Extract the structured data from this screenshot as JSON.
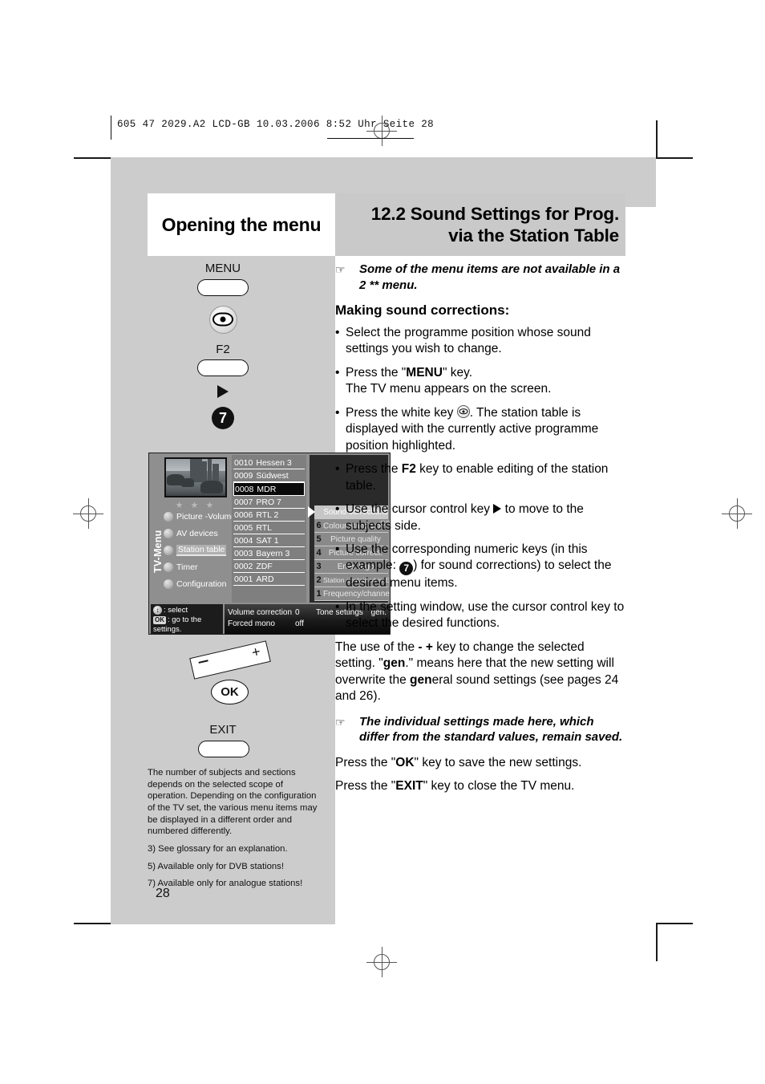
{
  "slug": "605 47 2029.A2 LCD-GB  10.03.2006  8:52 Uhr  Seite 28",
  "titles": {
    "left": "Opening the menu",
    "right_line1": "12.2 Sound Settings for Prog.",
    "right_line2": "via the Station Table"
  },
  "keys": {
    "menu_label": "MENU",
    "f2_label": "F2",
    "number_key": "7",
    "ok_label": "OK",
    "exit_label": "EXIT",
    "minus": "–",
    "plus": "+"
  },
  "tv": {
    "vertical_label": "TV-Menu",
    "stars": "★ ★ ★",
    "menu_items": [
      {
        "label": "Picture -Volume",
        "selected": false
      },
      {
        "label": "AV devices",
        "selected": false
      },
      {
        "label": "Station table",
        "selected": true
      },
      {
        "label": "Timer",
        "selected": false
      },
      {
        "label": "Configuration",
        "selected": false
      }
    ],
    "stations": [
      {
        "no": "0010",
        "name": "Hessen 3",
        "active": false
      },
      {
        "no": "0009",
        "name": "Südwest",
        "active": false
      },
      {
        "no": "0008",
        "name": "MDR",
        "active": true
      },
      {
        "no": "0007",
        "name": "PRO 7",
        "active": false
      },
      {
        "no": "0006",
        "name": "RTL 2",
        "active": false
      },
      {
        "no": "0005",
        "name": "RTL",
        "active": false
      },
      {
        "no": "0004",
        "name": "SAT 1",
        "active": false
      },
      {
        "no": "0003",
        "name": "Bayern 3",
        "active": false
      },
      {
        "no": "0002",
        "name": "ZDF",
        "active": false
      },
      {
        "no": "0001",
        "name": "ARD",
        "active": false
      }
    ],
    "subjects": [
      {
        "key": "",
        "label": "Sound corrections",
        "sup": "",
        "selected": true
      },
      {
        "key": "6",
        "label": "Colour standard",
        "sup": "3)7)",
        "selected": false
      },
      {
        "key": "5",
        "label": "Picture quality",
        "sup": "",
        "selected": false
      },
      {
        "key": "4",
        "label": "Picture correct.",
        "sup": "",
        "selected": false
      },
      {
        "key": "3",
        "label": "Enter logo",
        "sup": "",
        "selected": false
      },
      {
        "key": "2",
        "label": "Station contained in EPG",
        "sup": "",
        "selected": false
      },
      {
        "key": "1",
        "label": "Frequency/channel",
        "sup": "",
        "selected": false
      }
    ],
    "hint": {
      "line1": ": select",
      "line2": ": go to the",
      "line3": "settings.",
      "ok_badge": "OK"
    },
    "status": {
      "label1": "Volume correction",
      "value1": "0",
      "label2": "Tone settings",
      "value2": "gen.",
      "label3": "Forced mono",
      "value3": "off"
    }
  },
  "right": {
    "note1": "Some of the menu items are not available in a 2 ** menu.",
    "subhead": "Making sound corrections:",
    "b1": "Select the programme position whose sound settings you wish to change.",
    "b2_a": "Press the \"",
    "b2_b": "MENU",
    "b2_c": "\" key.",
    "b2_d": "The TV menu appears on the screen.",
    "b3_a": "Press the white key ",
    "b3_b": ". The station table is displayed with the currently active programme position highlighted.",
    "b4_a": "Press the ",
    "b4_b": "F2",
    "b4_c": " key to enable editing of the station table.",
    "b5_a": "Use the cursor control key ",
    "b5_b": " to move to the subjects side.",
    "b6_a": "Use the corresponding numeric keys (in this example: ",
    "b6_b": "7",
    "b6_c": ") for sound corrections) to select the desired menu items.",
    "b7": "In the setting window, use the cursor control key to select the desired functions.",
    "p1_a": "The use of the ",
    "p1_minus": "-",
    "p1_plus": "+",
    "p1_b": " key to change the selected setting. \"",
    "p1_gen": "gen",
    "p1_c": ".\" means here that the new setting will overwrite the ",
    "p1_gen2": "gen",
    "p1_d": "eral sound settings (see pages 24 and 26).",
    "note2": "The individual settings made here, which differ from the standard values, remain saved.",
    "p2_a": "Press the \"",
    "p2_ok": "OK",
    "p2_b": "\" key to save the new settings.",
    "p3_a": "Press the \"",
    "p3_exit": "EXIT",
    "p3_b": "\" key to close the TV menu."
  },
  "footnotes": {
    "main": "The number of subjects and sections depends on the selected scope of operation. Depending on the configuration of the TV set, the various menu items may be displayed in a different order and numbered differently.",
    "f3": "3) See glossary for an explanation.",
    "f5": "5) Available only for DVB stations!",
    "f7": "7) Available only for analogue stations!"
  },
  "page_number": "28"
}
